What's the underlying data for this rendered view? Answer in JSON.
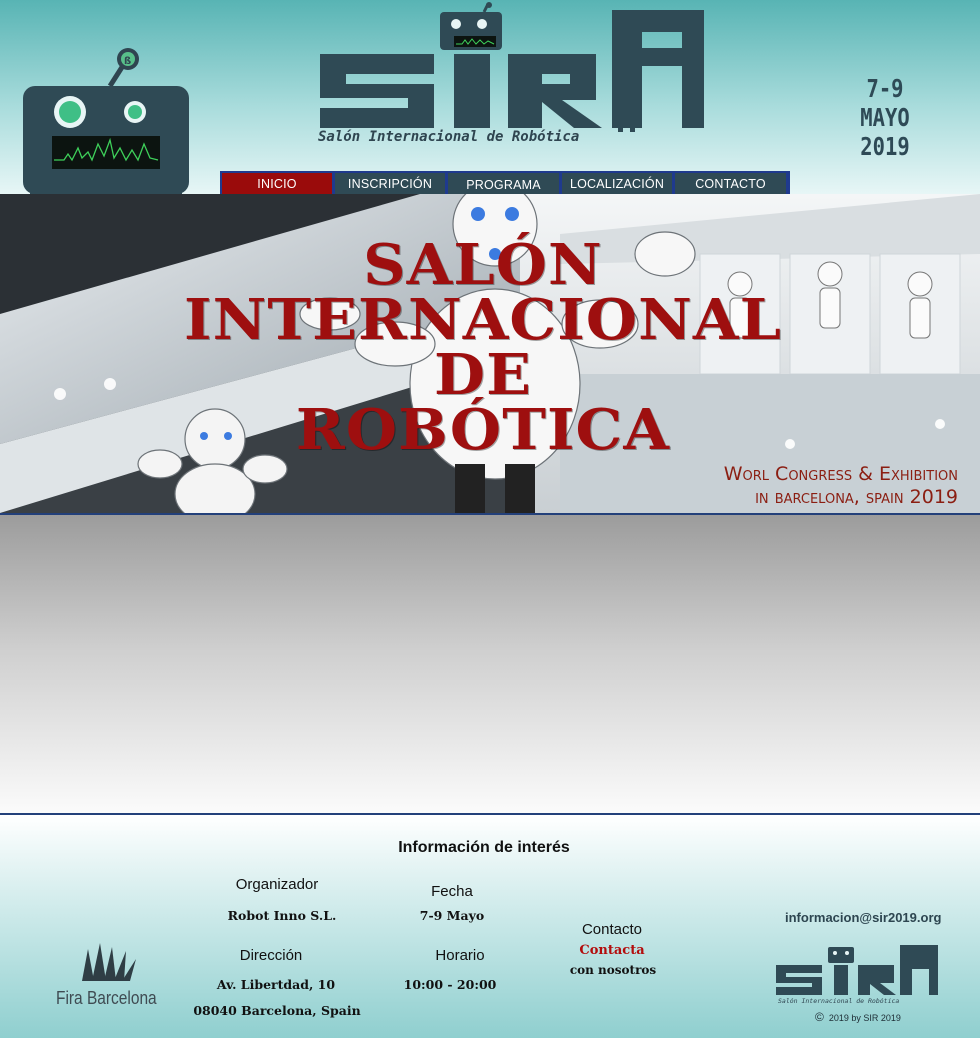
{
  "header": {
    "brand_name": "SIR",
    "tagline": "Salón Internacional de Robótica",
    "dates_line1": "7-9",
    "dates_line2": "MAYO 2019"
  },
  "nav": {
    "items": [
      {
        "label": "Inicio",
        "active": true
      },
      {
        "label": "Inscripción",
        "active": false
      },
      {
        "label": "Programa",
        "active": false
      },
      {
        "label": "localización",
        "active": false
      },
      {
        "label": "contacto",
        "active": false
      }
    ]
  },
  "hero": {
    "title_lines": [
      "SALÓN",
      "INTERNACIONAL",
      "DE",
      "ROBÓTICA"
    ],
    "subtitle_line1": "Worl Congress & Exhibition",
    "subtitle_line2": "in barcelona, spain 2019"
  },
  "footer": {
    "heading": "Información de interés",
    "organizer_label": "Organizador",
    "organizer_value": "Robot Inno S.L.",
    "address_label": "Dirección",
    "address_line1": "Av. Libertdad, 10",
    "address_line2": "08040 Barcelona, Spain",
    "date_label": "Fecha",
    "date_value": "7-9 Mayo",
    "hours_label": "Horario",
    "hours_value": "10:00 - 20:00",
    "contact_label": "Contacto",
    "contact_link": "Contacta",
    "contact_suffix": "con nosotros",
    "email": "informacion@sir2019.org",
    "partner_logo": "Fira Barcelona",
    "mini_tagline": "Salón Internacional de Robótica",
    "copyright": "2019 by  SIR 2019"
  },
  "colors": {
    "accent_red": "#9e0f0f",
    "nav_bg": "#2f4a55",
    "nav_active": "#9a0b0b",
    "header_teal": "#58b4b4"
  }
}
